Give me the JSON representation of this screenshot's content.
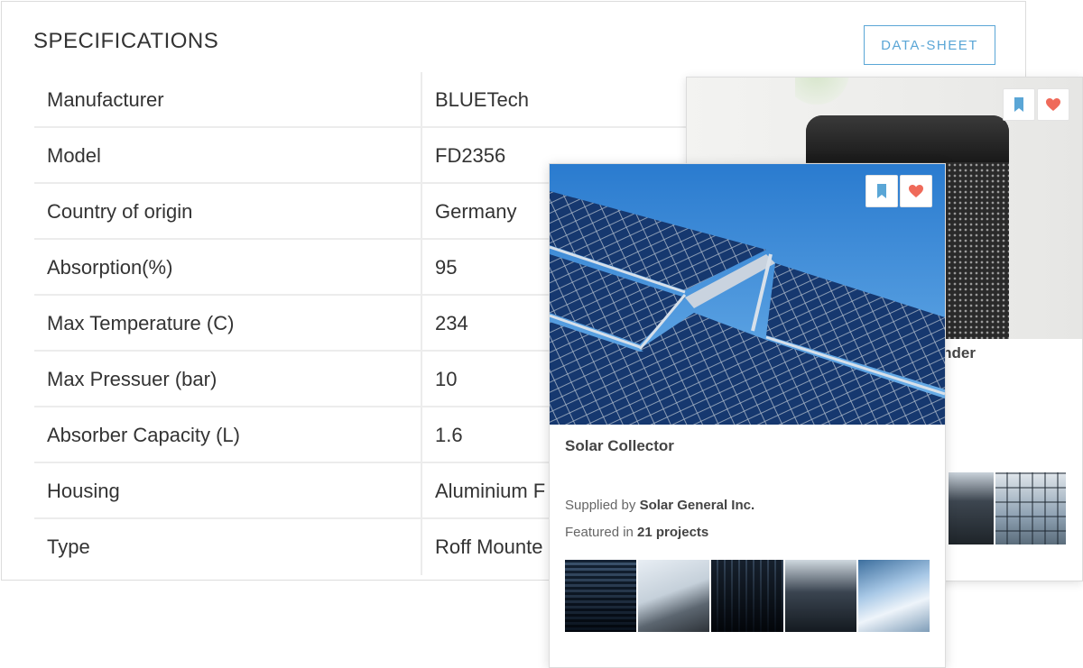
{
  "specifications": {
    "title": "SPECIFICATIONS",
    "datasheet_label": "DATA-SHEET",
    "rows": [
      {
        "label": "Manufacturer",
        "value": "BLUETech"
      },
      {
        "label": "Model",
        "value": "FD2356"
      },
      {
        "label": "Country of origin",
        "value": "Germany"
      },
      {
        "label": "Absorption(%)",
        "value": "95"
      },
      {
        "label": "Max Temperature (C)",
        "value": "234"
      },
      {
        "label": "Max Pressuer (bar)",
        "value": "10"
      },
      {
        "label": "Absorber Capacity (L)",
        "value": "1.6"
      },
      {
        "label": "Housing",
        "value": "Aluminium F"
      },
      {
        "label": "Type",
        "value": "Roff Mounte"
      }
    ]
  },
  "back_card": {
    "title_fragment": "nder",
    "icons": {
      "bookmark": "bookmark-icon",
      "heart": "heart-icon"
    }
  },
  "front_card": {
    "title": "Solar Collector",
    "supplied_prefix": "Supplied by ",
    "supplier": "Solar General Inc.",
    "featured_prefix": "Featured in ",
    "featured_count": "21 projects",
    "icons": {
      "bookmark": "bookmark-icon",
      "heart": "heart-icon"
    }
  },
  "colors": {
    "accent_blue": "#5aa6d6",
    "heart_red": "#ef6a5a"
  }
}
